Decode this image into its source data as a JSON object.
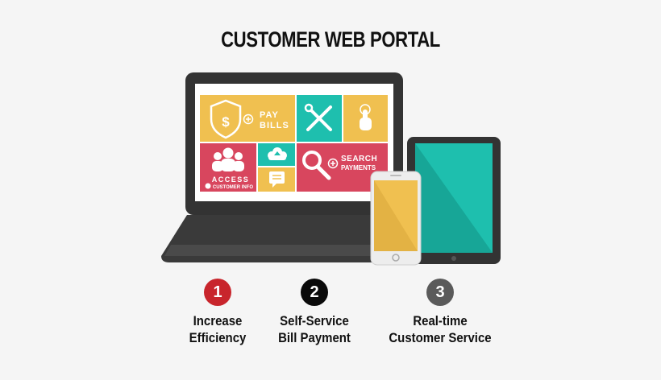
{
  "title": "CUSTOMER WEB PORTAL",
  "screen_tiles": {
    "pay": {
      "line1": "PAY",
      "line2": "BILLS"
    },
    "access": {
      "line1": "ACCESS",
      "line2": "CUSTOMER INFO"
    },
    "search": {
      "line1": "SEARCH",
      "line2": "PAYMENTS"
    }
  },
  "steps": [
    {
      "number": "1",
      "line1": "Increase",
      "line2": "Efficiency",
      "color": "#c8252c"
    },
    {
      "number": "2",
      "line1": "Self-Service",
      "line2": "Bill Payment",
      "color": "#0a0a0a"
    },
    {
      "number": "3",
      "line1": "Real-time",
      "line2": "Customer Service",
      "color": "#5a5a5a"
    }
  ],
  "colors": {
    "yellow": "#f0c050",
    "teal": "#1ebfae",
    "red": "#d8465e",
    "device_dark": "#333333"
  },
  "icons": [
    "dollar-shield-icon",
    "tools-icon",
    "touch-hand-icon",
    "users-icon",
    "cloud-upload-icon",
    "chat-icon",
    "search-icon",
    "info-icon",
    "plus-icon"
  ]
}
